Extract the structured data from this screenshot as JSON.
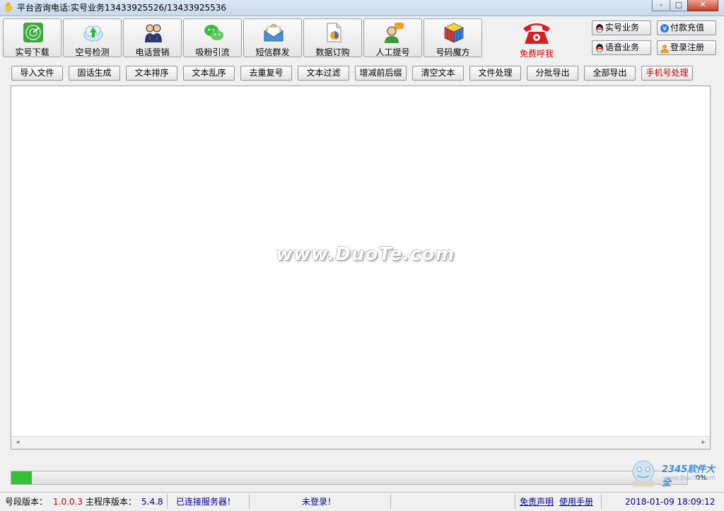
{
  "window": {
    "title": "平台咨询电话:实号业务13433925526/13433925536",
    "controls": [
      "minimize",
      "maximize",
      "close"
    ]
  },
  "toolbar": [
    {
      "label": "实号下载",
      "icon": "radar-icon"
    },
    {
      "label": "空号检测",
      "icon": "cloud-upload-icon"
    },
    {
      "label": "电话营销",
      "icon": "business-people-icon"
    },
    {
      "label": "吸粉引流",
      "icon": "wechat-icon"
    },
    {
      "label": "短信群发",
      "icon": "envelope-icon"
    },
    {
      "label": "数据订购",
      "icon": "pie-document-icon"
    },
    {
      "label": "人工提号",
      "icon": "support-agent-icon"
    },
    {
      "label": "号码魔方",
      "icon": "rubiks-cube-icon"
    }
  ],
  "call_me": {
    "label": "免费呼我",
    "icon": "red-telephone-icon"
  },
  "side_buttons": [
    {
      "label": "实号业务",
      "icon": "qq-penguin-icon"
    },
    {
      "label": "付款充值",
      "icon": "recharge-icon"
    },
    {
      "label": "语音业务",
      "icon": "qq-penguin-icon"
    },
    {
      "label": "登录注册",
      "icon": "user-login-icon"
    }
  ],
  "functions": [
    {
      "label": "导入文件"
    },
    {
      "label": "固话生成"
    },
    {
      "label": "文本排序"
    },
    {
      "label": "文本乱序"
    },
    {
      "label": "去重复号"
    },
    {
      "label": "文本过滤"
    },
    {
      "label": "增减前后缀"
    },
    {
      "label": "清空文本"
    },
    {
      "label": "文件处理"
    },
    {
      "label": "分批导出"
    },
    {
      "label": "全部导出"
    },
    {
      "label": "手机号处理"
    }
  ],
  "watermark": "www.DuoTe.com",
  "progress": {
    "value": 0.03,
    "text": "0%"
  },
  "status": {
    "segment_label": "号段版本：",
    "segment_version": "1.0.0.3",
    "main_label": "主程序版本：",
    "main_version": "5.4.8",
    "server": "已连接服务器！",
    "login": "未登录！",
    "disclaimer": "免责声明",
    "manual": "使用手册",
    "datetime": "2018-01-09 18:09:12"
  },
  "logo": {
    "text": "2345软件大全",
    "sub": "www.DuoTe.com"
  },
  "colors": {
    "accent_red": "#c00000",
    "link_blue": "#00008b",
    "progress_green": "#36c036"
  }
}
